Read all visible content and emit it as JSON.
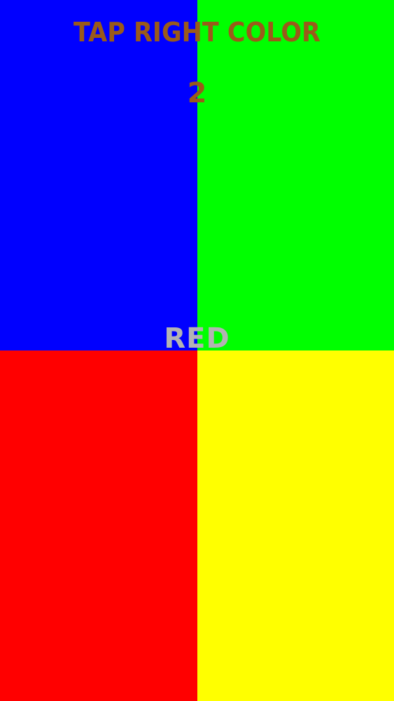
{
  "game": {
    "title": "TAP RIGHT COLOR",
    "score": "2",
    "prompt_word": "RED"
  },
  "colors": {
    "title_text": "#9a5a1a",
    "score_text": "#9a5a1a",
    "prompt_text": "#b3b3b3",
    "tile_blue": "#0000ff",
    "tile_green": "#00ff00",
    "tile_red": "#ff0000",
    "tile_yellow": "#ffff00"
  },
  "tiles": [
    {
      "name": "blue",
      "color": "#0000ff"
    },
    {
      "name": "green",
      "color": "#00ff00"
    },
    {
      "name": "red",
      "color": "#ff0000"
    },
    {
      "name": "yellow",
      "color": "#ffff00"
    }
  ]
}
